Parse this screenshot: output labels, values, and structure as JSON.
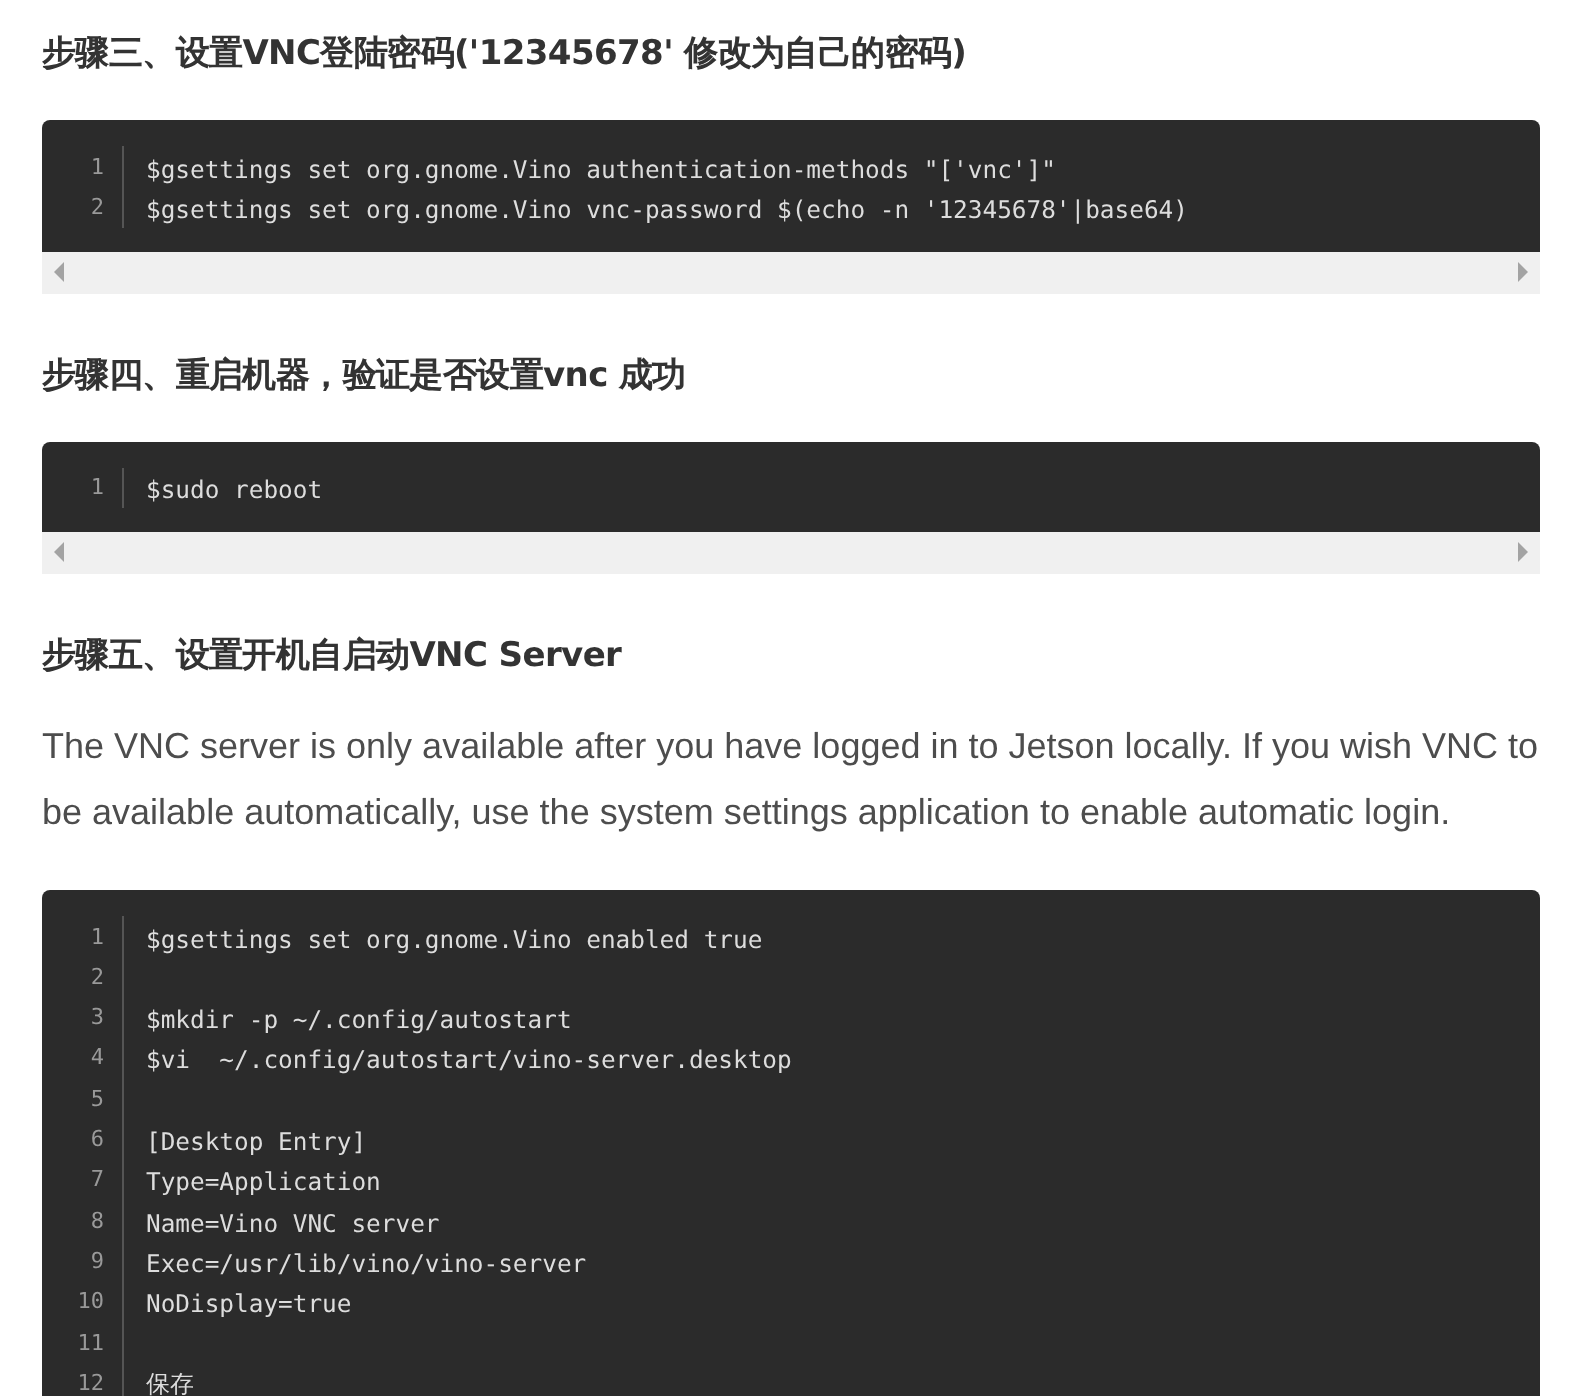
{
  "sections": [
    {
      "kind": "heading",
      "text": "步骤三、设置VNC登陆密码('12345678' 修改为自己的密码)"
    },
    {
      "kind": "code",
      "scrollbar": true,
      "lines": [
        {
          "number": "1",
          "code": "$gsettings set org.gnome.Vino authentication-methods \"['vnc']\""
        },
        {
          "number": "2",
          "code": "$gsettings set org.gnome.Vino vnc-password $(echo -n '12345678'|base64)"
        }
      ]
    },
    {
      "kind": "heading",
      "text": "步骤四、重启机器，验证是否设置vnc 成功"
    },
    {
      "kind": "code",
      "scrollbar": true,
      "lines": [
        {
          "number": "1",
          "code": "$sudo reboot"
        }
      ]
    },
    {
      "kind": "heading",
      "text": "步骤五、设置开机自启动VNC Server"
    },
    {
      "kind": "paragraph",
      "text": "The VNC server is only available after you have logged in to Jetson locally. If you wish VNC to be available automatically, use the system settings application to enable automatic login."
    },
    {
      "kind": "code",
      "scrollbar": false,
      "lines": [
        {
          "number": "1",
          "code": "$gsettings set org.gnome.Vino enabled true"
        },
        {
          "number": "2"
        },
        {
          "number": "3",
          "code": "$mkdir -p ~/.config/autostart"
        },
        {
          "number": "4",
          "code": "$vi  ~/.config/autostart/vino-server.desktop"
        },
        {
          "number": "5"
        },
        {
          "number": "6",
          "code": "[Desktop Entry]"
        },
        {
          "number": "7",
          "code": "Type=Application"
        },
        {
          "number": "8",
          "code": "Name=Vino VNC server"
        },
        {
          "number": "9",
          "code": "Exec=/usr/lib/vino/vino-server"
        },
        {
          "number": "10",
          "code": "NoDisplay=true"
        },
        {
          "number": "11"
        },
        {
          "number": "12",
          "code": "保存"
        }
      ]
    }
  ]
}
